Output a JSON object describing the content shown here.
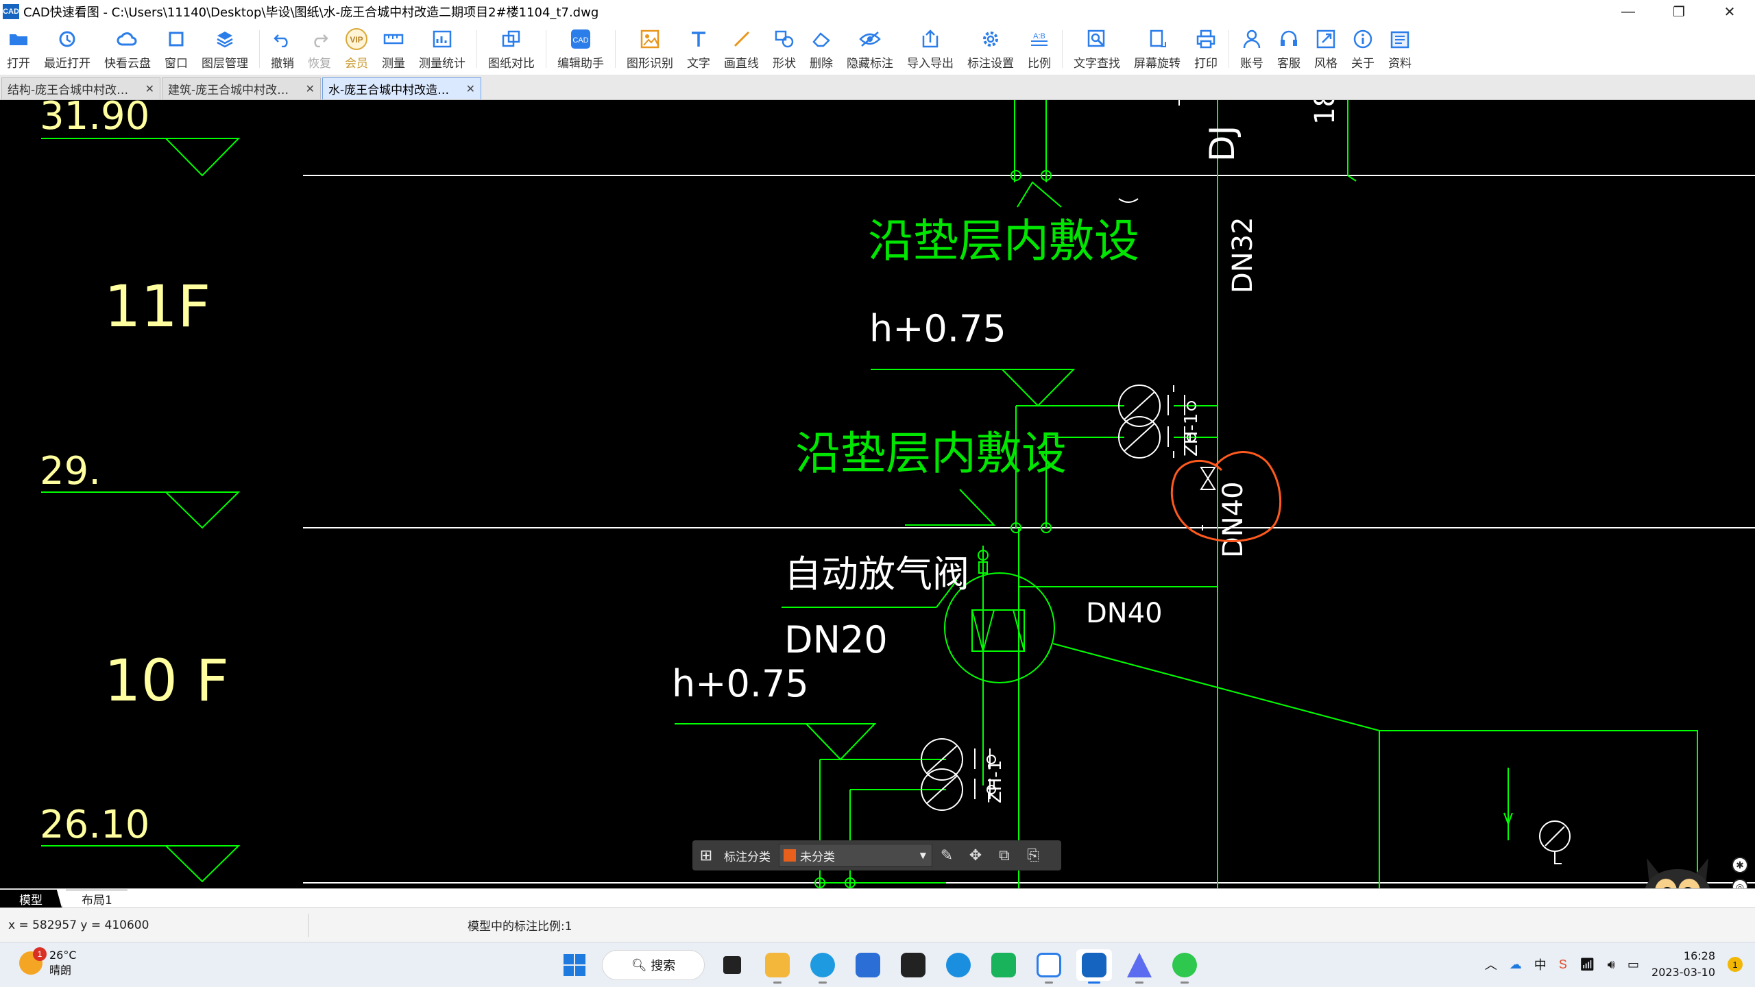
{
  "window": {
    "app_icon": "CAD",
    "title": "CAD快速看图 - C:\\Users\\11140\\Desktop\\毕设\\图纸\\水-庞王合城中村改造二期项目2#楼1104_t7.dwg",
    "controls": [
      "minimize-icon",
      "restore-icon",
      "close-icon"
    ]
  },
  "toolbar": {
    "open": "打开",
    "recent": "最近打开",
    "cloud": "快看云盘",
    "window": "窗口",
    "layers": "图层管理",
    "undo": "撤销",
    "redo": "恢复",
    "vip": "会员",
    "measure": "测量",
    "measure_stats": "测量统计",
    "compare": "图纸对比",
    "edit_helper": "编辑助手",
    "shape_recog": "图形识别",
    "text": "文字",
    "line": "画直线",
    "shape": "形状",
    "delete": "删除",
    "hide_anno": "隐藏标注",
    "import_export": "导入导出",
    "anno_settings": "标注设置",
    "ratio": "比例",
    "find_text": "文字查找",
    "rotate": "屏幕旋转",
    "print": "打印",
    "account": "账号",
    "service": "客服",
    "style": "风格",
    "about": "关于",
    "docs": "资料"
  },
  "tabs": [
    {
      "label": "结构-庞王合城中村改…",
      "active": false
    },
    {
      "label": "建筑-庞王合城中村改…",
      "active": false
    },
    {
      "label": "水-庞王合城中村改造…",
      "active": true
    }
  ],
  "drawing": {
    "elev_3190": "31.90",
    "floor_11": "11F",
    "elev_29": "29.",
    "floor_10": "10 F",
    "elev_2610": "26.10",
    "note_upper": "沿垫层内敷设",
    "note_lower": "沿垫层内敷设",
    "h_upper": "h+0.75",
    "h_lower": "h+0.75",
    "auto_valve": "自动放气阀",
    "dn20": "DN20",
    "dn40_h": "DN40",
    "dn40_v": "DN40",
    "dn32": "DN32",
    "dj": "DJ",
    "frag_18": "18",
    "colors": {
      "bg": "#000000",
      "line": "#00ff00",
      "white": "#ffffff",
      "green_text": "#00e600",
      "yellow_text": "#ffffa0",
      "markup": "#ff5a1e"
    }
  },
  "anno_bar": {
    "label": "标注分类",
    "selected": "未分类",
    "swatch_color": "#e8601c",
    "buttons": [
      "edit-icon",
      "move-icon",
      "copy-icon",
      "paste-icon"
    ]
  },
  "layout_tabs": [
    "模型",
    "布局1"
  ],
  "status": {
    "coords": "x = 582957  y = 410600",
    "scale": "模型中的标注比例:1"
  },
  "taskbar": {
    "weather_temp": "26°C",
    "weather_desc": "晴朗",
    "weather_badge": "1",
    "search": "搜索",
    "ime": "中",
    "time": "16:28",
    "date": "2023-03-10",
    "notif": "1"
  }
}
